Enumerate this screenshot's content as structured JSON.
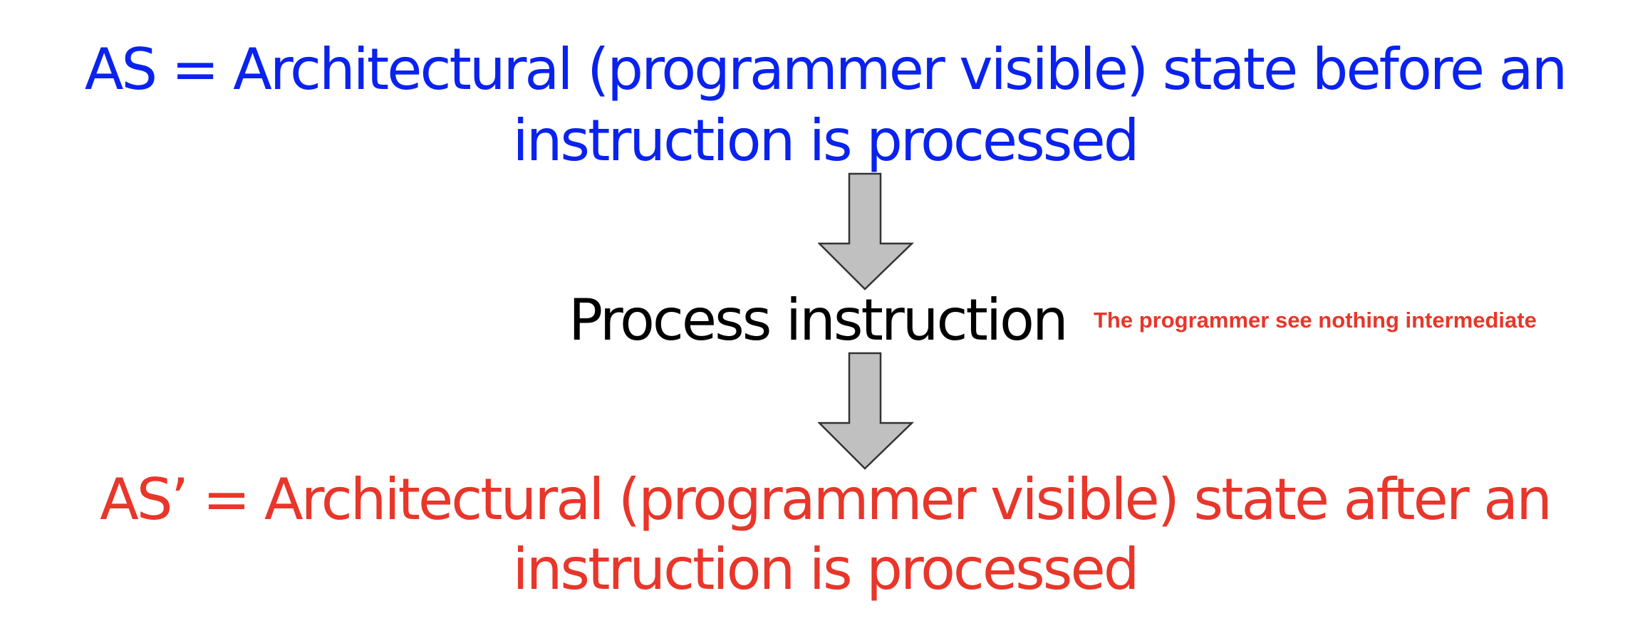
{
  "before_state": {
    "line1": "AS = Architectural (programmer visible) state before an",
    "line2": "instruction is processed",
    "color": "#0a22ee"
  },
  "process": {
    "label": "Process instruction",
    "note": "The programmer see nothing intermediate",
    "note_color": "#e8362a"
  },
  "after_state": {
    "line1": "AS’ = Architectural (programmer visible) state after an",
    "line2": "instruction is processed",
    "color": "#e8362a"
  },
  "arrows": {
    "fill": "#c0c0c0",
    "stroke": "#333333",
    "icon": "down-arrow-icon"
  }
}
